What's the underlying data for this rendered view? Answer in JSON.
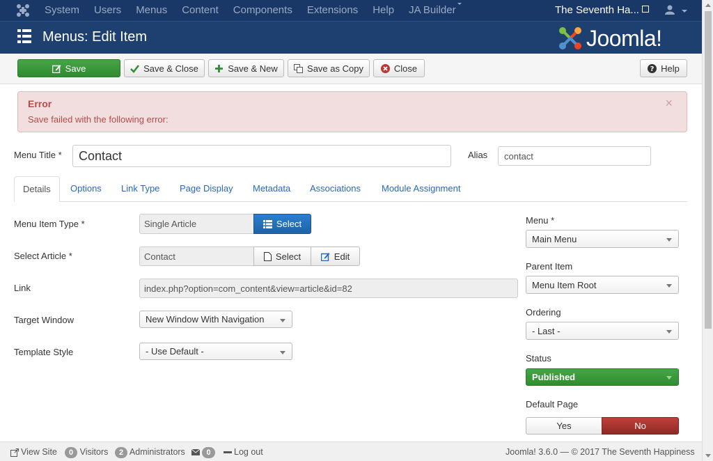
{
  "topnav": {
    "menu": [
      "System",
      "Users",
      "Menus",
      "Content",
      "Components",
      "Extensions",
      "Help",
      "JA Builder"
    ],
    "site_name": "The Seventh Ha..."
  },
  "header": {
    "title": "Menus: Edit Item",
    "brand": "Joomla!"
  },
  "toolbar": {
    "save": "Save",
    "save_close": "Save & Close",
    "save_new": "Save & New",
    "save_copy": "Save as Copy",
    "close": "Close",
    "help": "Help"
  },
  "alert": {
    "heading": "Error",
    "message": "Save failed with the following error:",
    "dismiss": "×"
  },
  "form": {
    "menu_title_label": "Menu Title *",
    "menu_title_value": "Contact",
    "alias_label": "Alias",
    "alias_value": "contact"
  },
  "tabs": [
    "Details",
    "Options",
    "Link Type",
    "Page Display",
    "Metadata",
    "Associations",
    "Module Assignment"
  ],
  "details": {
    "menu_item_type_label": "Menu Item Type *",
    "menu_item_type_value": "Single Article",
    "select_label": "Select",
    "select_article_label": "Select Article *",
    "select_article_value": "Contact",
    "article_select": "Select",
    "article_edit": "Edit",
    "link_label": "Link",
    "link_value": "index.php?option=com_content&view=article&id=82",
    "target_window_label": "Target Window",
    "target_window_value": "New Window With Navigation",
    "template_style_label": "Template Style",
    "template_style_value": "- Use Default -"
  },
  "sidebar": {
    "menu_label": "Menu *",
    "menu_value": "Main Menu",
    "parent_label": "Parent Item",
    "parent_value": "Menu Item Root",
    "ordering_label": "Ordering",
    "ordering_value": "- Last -",
    "status_label": "Status",
    "status_value": "Published",
    "default_page_label": "Default Page",
    "default_yes": "Yes",
    "default_no": "No"
  },
  "footer": {
    "view_site": "View Site",
    "visitors_count": "0",
    "visitors": "Visitors",
    "admins_count": "2",
    "admins": "Administrators",
    "messages_count": "0",
    "logout": "Log out",
    "version": "Joomla! 3.6.0",
    "copyright": "— © 2017 The Seventh Happiness"
  },
  "colors": {
    "nav_bg": "#1a3867",
    "header_bg": "#1d4071",
    "success": "#46a546",
    "primary": "#2a7fcf",
    "danger": "#b94a48",
    "link": "#2a69b8"
  }
}
